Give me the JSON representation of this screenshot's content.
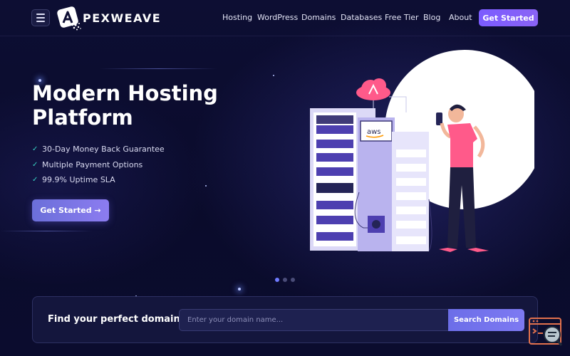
{
  "brand": {
    "name": "PEXWEAVE"
  },
  "nav": {
    "links": [
      "Hosting",
      "WordPress",
      "Domains",
      "Databases",
      "Free Tier",
      "Blog",
      "About"
    ],
    "cta": "Get Started"
  },
  "hero": {
    "title_line1": "Modern Hosting",
    "title_line2": "Platform",
    "features": [
      "30-Day Money Back Guarantee",
      "Multiple Payment Options",
      "99.9% Uptime SLA"
    ],
    "cta": "Get Started →",
    "illustration_badge": "aws"
  },
  "slider": {
    "count": 3,
    "active": 0
  },
  "domain_search": {
    "label": "Find your perfect domain",
    "placeholder": "Enter your domain name...",
    "button": "Search Domains"
  },
  "colors": {
    "background": "#0b0c2e",
    "accent": "#7b5cff",
    "check": "#38d3c4"
  },
  "icons": [
    "menu-icon",
    "logo-icon",
    "check-icon",
    "cloud-icon",
    "chat-support-icon"
  ]
}
